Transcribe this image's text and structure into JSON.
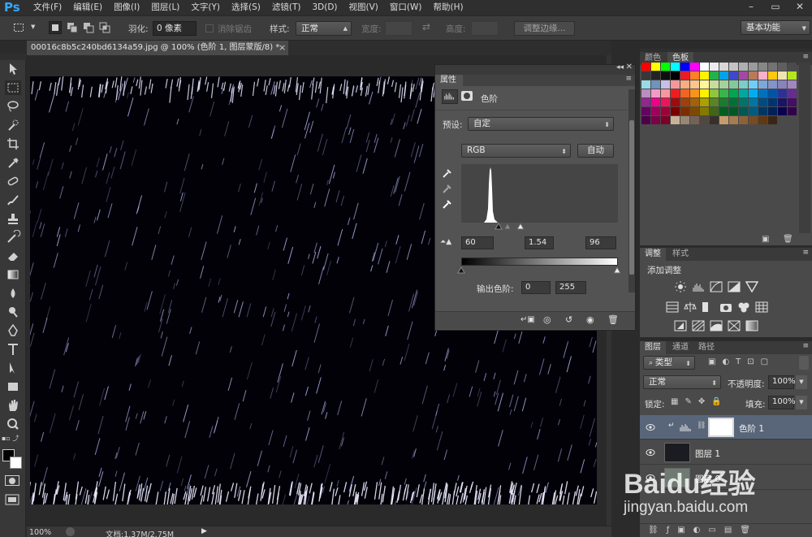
{
  "app": {
    "logo": "Ps"
  },
  "menu": [
    "文件(F)",
    "编辑(E)",
    "图像(I)",
    "图层(L)",
    "文字(Y)",
    "选择(S)",
    "滤镜(T)",
    "3D(D)",
    "视图(V)",
    "窗口(W)",
    "帮助(H)"
  ],
  "options": {
    "feather_label": "羽化:",
    "feather_value": "0 像素",
    "antialias_label": "消除锯齿",
    "style_label": "样式:",
    "style_value": "正常",
    "width_label": "宽度:",
    "height_label": "高度:",
    "refine_edge_label": "调整边缘...",
    "workspace_value": "基本功能"
  },
  "document": {
    "tab_title": "00016c8b5c240bd6134a59.jpg @ 100% (色阶 1, 图层蒙版/8) *",
    "close_glyph": "×"
  },
  "status": {
    "zoom": "100%",
    "doc_info": "文档:1.37M/2.75M"
  },
  "properties": {
    "tab_label": "属性",
    "title": "色阶",
    "preset_label": "预设:",
    "preset_value": "自定",
    "channel_value": "RGB",
    "auto_label": "自动",
    "input_black": "60",
    "input_gamma": "1.54",
    "input_white": "96",
    "output_label": "输出色阶:",
    "output_black": "0",
    "output_white": "255"
  },
  "swatches_panel": {
    "tabs": [
      "颜色",
      "色板"
    ],
    "active_tab": 1,
    "rows": [
      [
        "#ff0000",
        "#ffff00",
        "#00ff00",
        "#00ffff",
        "#0000ff",
        "#ff00ff",
        "#ffffff",
        "#ebebeb",
        "#d7d7d7",
        "#c3c3c3",
        "#afafaf",
        "#9b9b9b",
        "#878787",
        "#737373",
        "#5f5f5f",
        "#4b4b4b"
      ],
      [
        "#373737",
        "#232323",
        "#0f0f0f",
        "#000000",
        "#ed1c24",
        "#ff7f27",
        "#fff200",
        "#22b14c",
        "#00a2e8",
        "#3f48cc",
        "#a349a4",
        "#b97a57",
        "#ffaec9",
        "#ffc90e",
        "#efe4b0",
        "#b5e61d"
      ],
      [
        "#99d9ea",
        "#7092be",
        "#c8bfe7",
        "#f5989d",
        "#f9ad81",
        "#fdc68a",
        "#fff79a",
        "#c4df9b",
        "#a3d39c",
        "#82ca9d",
        "#7bcdc8",
        "#6ecff6",
        "#7ea7d8",
        "#8493ca",
        "#8882be",
        "#a187be"
      ],
      [
        "#bc8dbf",
        "#f49ac2",
        "#f6989d",
        "#ee1d24",
        "#f16522",
        "#f7941d",
        "#fff200",
        "#8dc63f",
        "#39b54a",
        "#00a651",
        "#00a99d",
        "#00aeef",
        "#0072bc",
        "#0054a6",
        "#2e3192",
        "#662d91"
      ],
      [
        "#92278f",
        "#ec008c",
        "#ed145b",
        "#9e0b0f",
        "#a0410d",
        "#a36209",
        "#aba000",
        "#598527",
        "#1a7b30",
        "#007236",
        "#00746b",
        "#0076a3",
        "#004b80",
        "#003471",
        "#1b1464",
        "#440e62"
      ],
      [
        "#630460",
        "#9e005d",
        "#9e0039",
        "#790000",
        "#7b2e00",
        "#7d4900",
        "#827b00",
        "#406618",
        "#005e20",
        "#005826",
        "#005952",
        "#005b7f",
        "#003663",
        "#002157",
        "#0d004c",
        "#32004b"
      ],
      [
        "#4b0049",
        "#7b0046",
        "#7a0026",
        "#c7b299",
        "#998675",
        "#736357",
        "#534741",
        "#37302a",
        "#c69c6d",
        "#a67c52",
        "#8c6239",
        "#754c24",
        "#603913",
        "#3c2415"
      ]
    ]
  },
  "adjustments_panel": {
    "tabs": [
      "调整",
      "样式"
    ],
    "active_tab": 0,
    "title": "添加调整"
  },
  "layers_panel": {
    "tabs": [
      "图层",
      "通道",
      "路径"
    ],
    "active_tab": 0,
    "filter_value": "类型",
    "blend_value": "正常",
    "opacity_label": "不透明度:",
    "opacity_value": "100%",
    "lock_label": "锁定:",
    "fill_label": "填充:",
    "fill_value": "100%",
    "layers": [
      {
        "name": "色阶 1"
      },
      {
        "name": "图层 1"
      },
      {
        "name": "图层 0"
      }
    ]
  },
  "watermark": {
    "brand": "Baidu经验",
    "url": "jingyan.baidu.com"
  },
  "colors": {
    "accent": "#31a8ff",
    "panel": "#535353",
    "selected_layer": "#59667a"
  }
}
